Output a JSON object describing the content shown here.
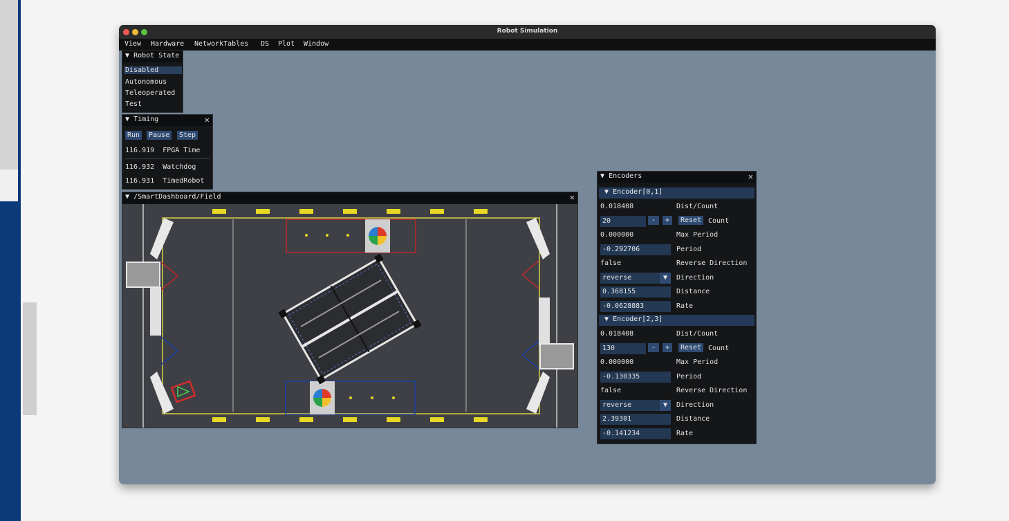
{
  "window": {
    "title": "Robot Simulation"
  },
  "menu": [
    "View",
    "Hardware",
    "NetworkTables",
    "DS",
    "Plot",
    "Window"
  ],
  "robot_state": {
    "title": "Robot State",
    "items": [
      "Disabled",
      "Autonomous",
      "Teleoperated",
      "Test"
    ],
    "selected": "Disabled"
  },
  "timing": {
    "title": "Timing",
    "buttons": [
      "Run",
      "Pause",
      "Step"
    ],
    "rows": [
      {
        "value": "116.919",
        "label": "FPGA Time"
      },
      {
        "value": "116.932",
        "label": "Watchdog"
      },
      {
        "value": "116.931",
        "label": "TimedRobot"
      }
    ]
  },
  "field": {
    "title": "/SmartDashboard/Field"
  },
  "encoders": {
    "title": "Encoders",
    "groups": [
      {
        "name": "Encoder[0,1]",
        "dist_count": "0.018408",
        "dist_count_label": "Dist/Count",
        "count": "20",
        "minus": "-",
        "plus": "+",
        "reset": "Reset",
        "count_label": "Count",
        "max_period": "0.000000",
        "max_period_label": "Max Period",
        "period": "-0.292706",
        "period_label": "Period",
        "reverse": "false",
        "reverse_label": "Reverse Direction",
        "direction": "reverse",
        "direction_label": "Direction",
        "distance": "0.368155",
        "distance_label": "Distance",
        "rate": "-0.0628883",
        "rate_label": "Rate"
      },
      {
        "name": "Encoder[2,3]",
        "dist_count": "0.018408",
        "dist_count_label": "Dist/Count",
        "count": "130",
        "minus": "-",
        "plus": "+",
        "reset": "Reset",
        "count_label": "Count",
        "max_period": "0.000000",
        "max_period_label": "Max Period",
        "period": "-0.130335",
        "period_label": "Period",
        "reverse": "false",
        "reverse_label": "Reverse Direction",
        "direction": "reverse",
        "direction_label": "Direction",
        "distance": "2.39301",
        "distance_label": "Distance",
        "rate": "-0.141234",
        "rate_label": "Rate"
      }
    ]
  },
  "colors": {
    "accent": "#2e4a72",
    "background": "#768899",
    "red_alliance": "#c0262a",
    "blue_alliance": "#1e3fa8"
  }
}
